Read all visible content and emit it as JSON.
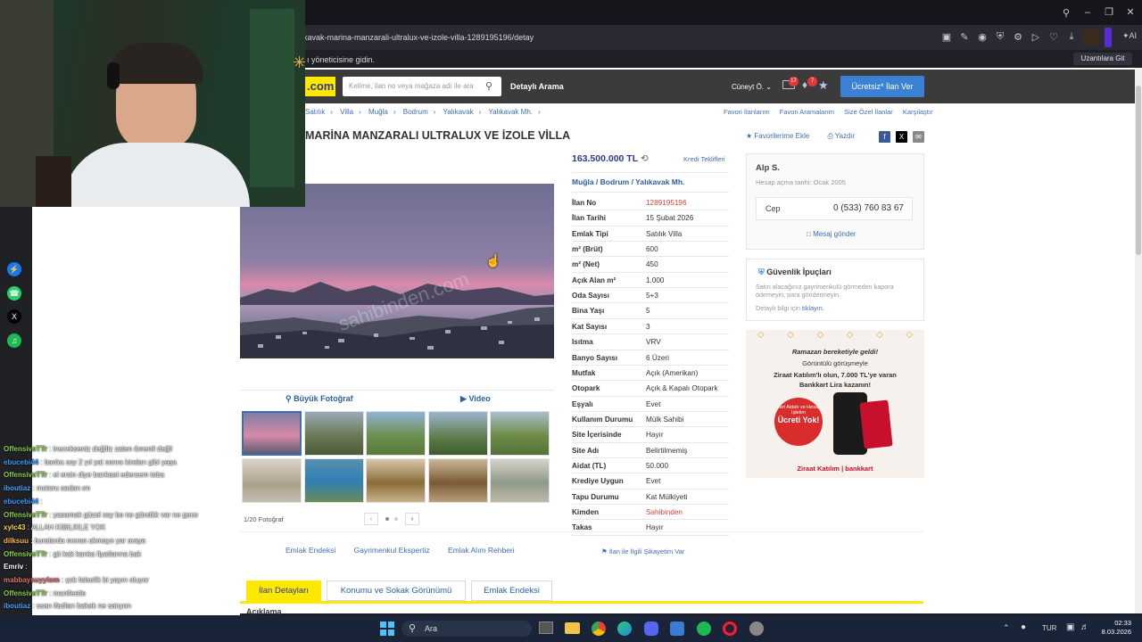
{
  "browser": {
    "url": "kavak-marina-manzarali-ultralux-ve-izole-villa-1289195196/detay",
    "message": "ı yöneticisine gidin.",
    "extensions_button": "Uzantılara Git"
  },
  "site": {
    "logo": ".com",
    "search_placeholder": "Kelime, ilan no veya mağaza adı ile ara",
    "detailed_search": "Detaylı Arama",
    "user": "Cüneyt Ö.",
    "mail_badge": "17",
    "notif_badge": "7",
    "free_listing": "Ücretsiz* İlan Ver"
  },
  "breadcrumb": [
    "Satılık",
    "Villa",
    "Muğla",
    "Bodrum",
    "Yalıkavak",
    "Yalıkavak Mh."
  ],
  "top_links": [
    "Favori İlanlarım",
    "Favori Aramalarım",
    "Size Özel İlanlar",
    "Karşılaştır"
  ],
  "listing": {
    "title": "MARİNA MANZARALI ULTRALUX VE İZOLE VİLLA",
    "add_favorite": "Favorilerime Ekle",
    "print": "Yazdır",
    "price": "163.500.000 TL",
    "credit_offers": "Kredi Teklifleri",
    "location": "Muğla  /  Bodrum  /  Yalıkavak Mh.",
    "big_photo": "Büyük Fotoğraf",
    "video": "Video",
    "photo_count": "1/20 Fotoğraf",
    "image_watermark": "sahibinden.com"
  },
  "details": [
    {
      "k": "İlan No",
      "v": "1289195196",
      "red": true
    },
    {
      "k": "İlan Tarihi",
      "v": "15 Şubat 2026"
    },
    {
      "k": "Emlak Tipi",
      "v": "Satılık Villa"
    },
    {
      "k": "m² (Brüt)",
      "v": "600"
    },
    {
      "k": "m² (Net)",
      "v": "450"
    },
    {
      "k": "Açık Alan m²",
      "v": "1.000"
    },
    {
      "k": "Oda Sayısı",
      "v": "5+3"
    },
    {
      "k": "Bina Yaşı",
      "v": "5"
    },
    {
      "k": "Kat Sayısı",
      "v": "3"
    },
    {
      "k": "Isıtma",
      "v": "VRV"
    },
    {
      "k": "Banyo Sayısı",
      "v": "6 Üzeri"
    },
    {
      "k": "Mutfak",
      "v": "Açık (Amerikan)"
    },
    {
      "k": "Otopark",
      "v": "Açık & Kapalı Otopark"
    },
    {
      "k": "Eşyalı",
      "v": "Evet"
    },
    {
      "k": "Kullanım Durumu",
      "v": "Mülk Sahibi"
    },
    {
      "k": "Site İçerisinde",
      "v": "Hayır"
    },
    {
      "k": "Site Adı",
      "v": "Belirtilmemiş"
    },
    {
      "k": "Aidat (TL)",
      "v": "50.000"
    },
    {
      "k": "Krediye Uygun",
      "v": "Evet"
    },
    {
      "k": "Tapu Durumu",
      "v": "Kat Mülkiyeti"
    },
    {
      "k": "Kimden",
      "v": "Sahibinden",
      "red": true
    },
    {
      "k": "Takas",
      "v": "Hayır"
    }
  ],
  "seller": {
    "name": "Alp S.",
    "since": "Hesap açma tarihi: Ocak 2005",
    "phone_type": "Cep",
    "phone": "0 (533) 760 83 67",
    "send_message": "Mesaj gönder"
  },
  "safety": {
    "title": "Güvenlik İpuçları",
    "text": "Satın alacağınız gayrimenkulü görmeden kapora ödemeyin, para göndermeyin.",
    "link_prefix": "Detaylı bilgi için",
    "link": "tıklayın."
  },
  "ad": {
    "line1": "Ramazan bereketiyle geldi!",
    "line2": "Görüntülü görüşmeyle",
    "line3": "Ziraat Katılım'lı olun, 7.000 TL'ye varan",
    "line4": "Bankkart Lira kazanın!",
    "bubble1": "Kart Aidatı ve Hesap İşletim",
    "bubble2": "Ücreti Yok!",
    "brand": "Ziraat Katılım | bankkart"
  },
  "bottom_links": [
    "Emlak Endeksi",
    "Gayrimenkul Ekspertiz",
    "Emlak Alım Rehberi"
  ],
  "complain": "İlan ile İlgili Şikayetim Var",
  "tabs": [
    "İlan Detayları",
    "Konumu ve Sokak Görünümü",
    "Emlak Endeksi"
  ],
  "description_label": "Açıklama",
  "chat": [
    {
      "u": "OffensiveTTr",
      "t": "inecekseniz değiliz zaten ömenil değil",
      "c": "#8bd14b"
    },
    {
      "u": "ebucebi44",
      "t": "banka ssy 2 yıl yat sonra kiraları gibi yaşa",
      "c": "#3a9bff"
    },
    {
      "u": "OffensiveTTr",
      "t": "el ersin diye bankaet edersem toba",
      "c": "#8bd14b"
    },
    {
      "u": "iboutiaz",
      "t": "motoru sadan ım",
      "c": "#4aa3ff"
    },
    {
      "u": "ebucebi44",
      "t": "",
      "c": "#3a9bff"
    },
    {
      "u": "OffensiveTTr",
      "t": "yasamak güzel ssy be ne gündük var ne gece",
      "c": "#8bd14b"
    },
    {
      "u": "xylc43",
      "t": "ALLAH KIBILIKLE YOK",
      "c": "#ffd54f"
    },
    {
      "u": "dilksuu",
      "t": "buralarda moran akmayo yar araya",
      "c": "#ffb74d"
    },
    {
      "u": "OffensiveTTr",
      "t": "git kak kanka fiyatlarına bak",
      "c": "#8bd14b"
    },
    {
      "u": "Emriv",
      "t": "",
      "c": "#ffffff"
    },
    {
      "u": "mabbaysuyylom",
      "t": "çok felsefik bi yayın oluyor",
      "c": "#e57373"
    },
    {
      "u": "OffensiveTTr",
      "t": "manifestle",
      "c": "#8bd14b"
    },
    {
      "u": "iboutiaz",
      "t": "ssan ifadları bakak ne satıyon",
      "c": "#4aa3ff"
    },
    {
      "u": "Emriv",
      "t": "reels azalt",
      "c": "#ffffff"
    },
    {
      "u": "dilksuu",
      "t": "bi sürü dkdir cok felsefik konusuyosunuz",
      "c": "#ffb74d"
    }
  ],
  "taskbar": {
    "search": "Ara",
    "lang": "TUR",
    "time": "02:33",
    "date": "8.03.2026"
  }
}
